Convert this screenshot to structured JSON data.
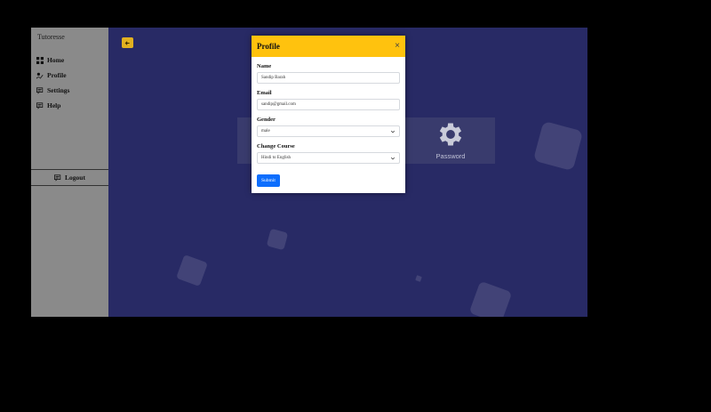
{
  "sidebar": {
    "brand": "Tutoresse",
    "items": [
      {
        "label": "Home"
      },
      {
        "label": "Profile"
      },
      {
        "label": "Settings"
      },
      {
        "label": "Help"
      }
    ],
    "logout_label": "Logout"
  },
  "main": {
    "password_card_label": "Password"
  },
  "modal": {
    "title": "Profile",
    "close_glyph": "×",
    "name_label": "Name",
    "name_value": "Sandip Barah",
    "email_label": "Email",
    "email_value": "sandip@gmail.com",
    "gender_label": "Gender",
    "gender_value": "male",
    "course_label": "Change Course",
    "course_value": "Hindi to English",
    "submit_label": "Submit"
  },
  "colors": {
    "sidebar_bg": "#8a8a8a",
    "main_bg": "#282a65",
    "modal_header": "#ffc20e",
    "submit": "#0d6efd",
    "toggle": "#e2b120"
  }
}
